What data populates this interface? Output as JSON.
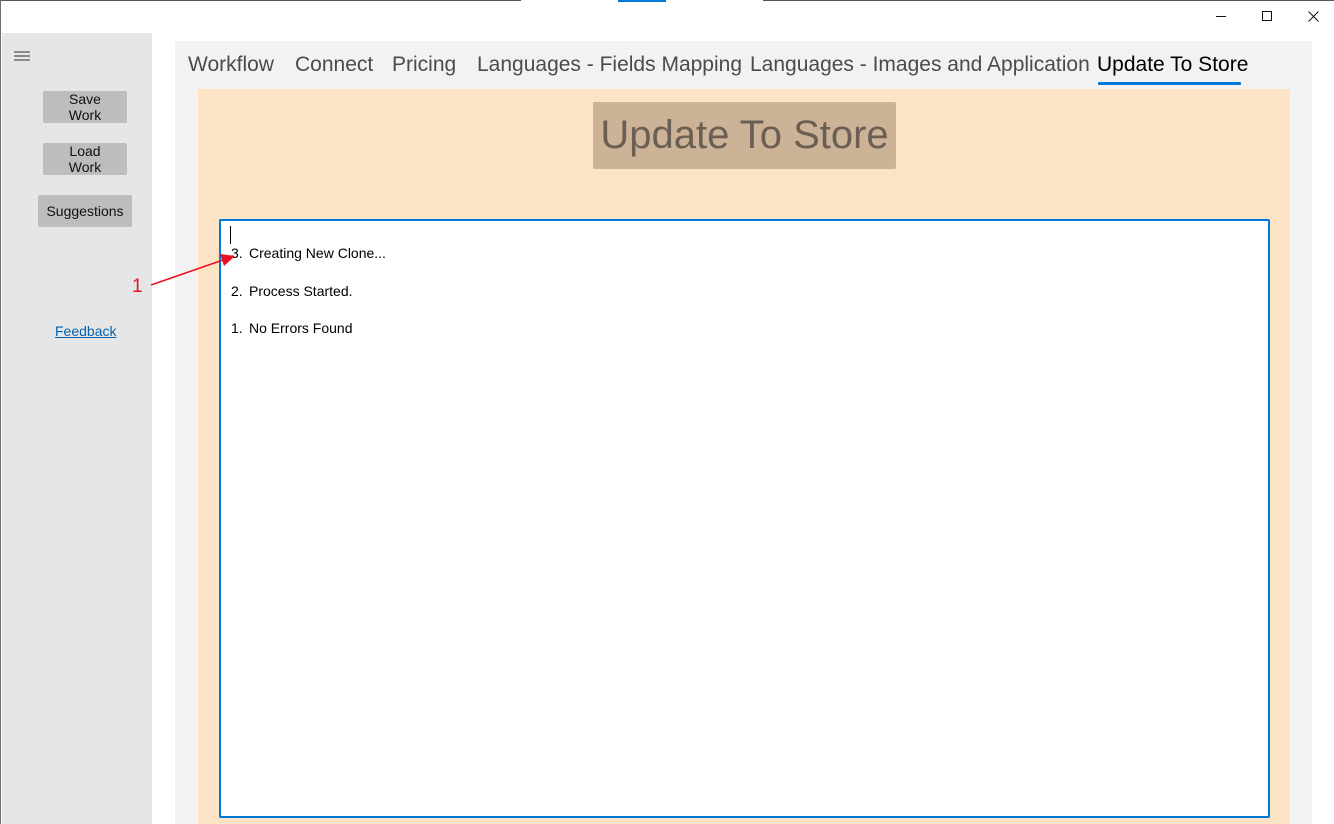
{
  "window": {
    "controls": {
      "minimize": "—",
      "maximize": "☐",
      "close": "✕"
    }
  },
  "sidebar": {
    "menu_icon": "hamburger-icon",
    "buttons": {
      "save_work": "Save Work",
      "load_work": "Load Work",
      "suggestions": "Suggestions"
    },
    "feedback_link": "Feedback"
  },
  "annotation": {
    "number": "1",
    "color": "#e81123"
  },
  "tabs": [
    {
      "label": "Workflow",
      "active": false
    },
    {
      "label": "Connect",
      "active": false
    },
    {
      "label": "Pricing",
      "active": false
    },
    {
      "label": "Languages - Fields Mapping",
      "active": false
    },
    {
      "label": "Languages - Images and Application",
      "active": false
    },
    {
      "label": "Update To Store",
      "active": true
    }
  ],
  "panel": {
    "title": "Update To Store",
    "background": "#fde3c5",
    "log": [
      {
        "num": "3.",
        "text": "Creating New Clone..."
      },
      {
        "num": "2.",
        "text": "Process Started."
      },
      {
        "num": "1.",
        "text": "No Errors Found"
      }
    ]
  },
  "colors": {
    "accent": "#0078d7",
    "sidebar": "#e6e6e6",
    "button": "#bdbdbd",
    "title_box": "#ccb296"
  }
}
